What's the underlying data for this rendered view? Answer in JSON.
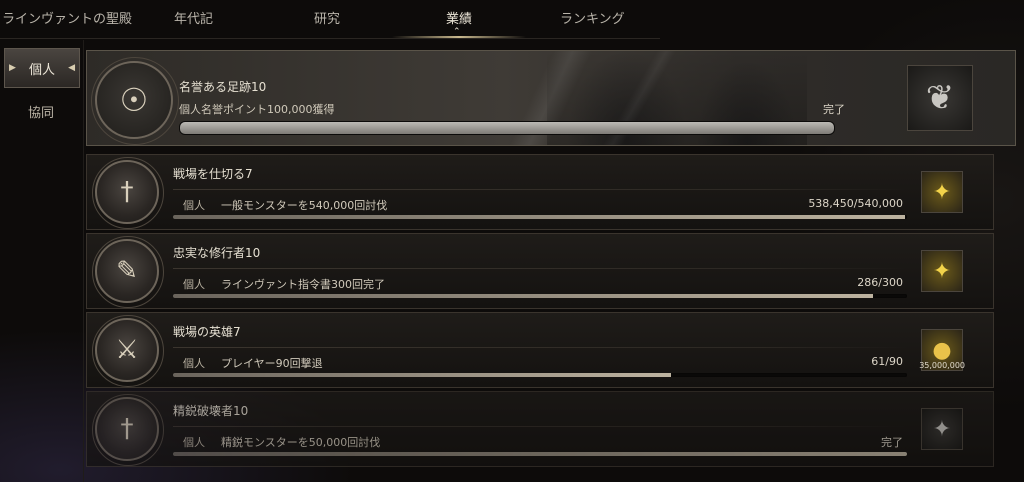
{
  "topnav": {
    "tabs": [
      {
        "label": "ラインヴァントの聖殿"
      },
      {
        "label": "年代記"
      },
      {
        "label": "研究"
      },
      {
        "label": "業績"
      },
      {
        "label": "ランキング"
      }
    ],
    "active": "業績"
  },
  "sidebar": {
    "items": [
      {
        "label": "個人",
        "active": true
      },
      {
        "label": "協同",
        "active": false
      }
    ]
  },
  "achievements": [
    {
      "title": "名誉ある足跡10",
      "description": "個人名誉ポイント100,000獲得",
      "status": "完了",
      "progress": 1.0,
      "featured": true,
      "emblem_icon": "eye-altar-icon",
      "reward_icon": "cloak-icon"
    },
    {
      "title": "戦場を仕切る7",
      "badge": "個人",
      "description": "一般モンスターを540,000回討伐",
      "status": "538,450/540,000",
      "progress": 0.997,
      "emblem_icon": "sword-wings-icon",
      "reward_icon": "gold-emblem-icon"
    },
    {
      "title": "忠実な修行者10",
      "badge": "個人",
      "description": "ラインヴァント指令書300回完了",
      "status": "286/300",
      "progress": 0.953,
      "emblem_icon": "scroll-icon",
      "reward_icon": "gold-emblem-icon"
    },
    {
      "title": "戦場の英雄7",
      "badge": "個人",
      "description": "プレイヤー90回撃退",
      "status": "61/90",
      "progress": 0.678,
      "emblem_icon": "crossed-axes-icon",
      "reward_icon": "gold-coin-icon",
      "reward_amount": "35,000,000"
    },
    {
      "title": "精鋭破壊者10",
      "badge": "個人",
      "description": "精鋭モンスターを50,000回討伐",
      "status": "完了",
      "progress": 1.0,
      "faded": true,
      "emblem_icon": "sword-wings-icon",
      "reward_icon": "silver-emblem-icon"
    }
  ]
}
